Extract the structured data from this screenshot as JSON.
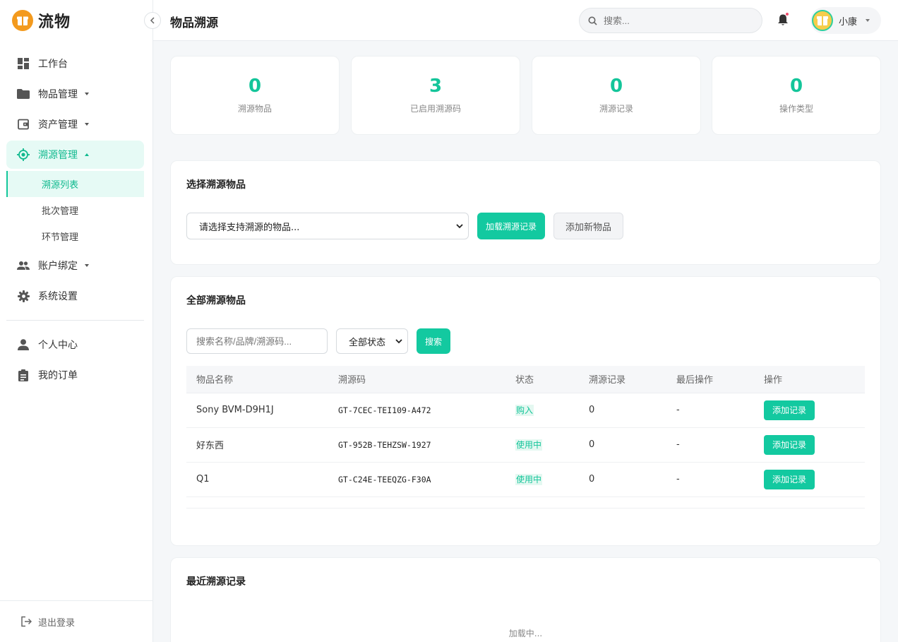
{
  "brand": {
    "name": "流物"
  },
  "header": {
    "title": "物品溯源",
    "search_placeholder": "搜索...",
    "user_name": "小康"
  },
  "sidebar": {
    "items": [
      {
        "label": "工作台"
      },
      {
        "label": "物品管理"
      },
      {
        "label": "资产管理"
      },
      {
        "label": "溯源管理"
      },
      {
        "label": "账户绑定"
      },
      {
        "label": "系统设置"
      },
      {
        "label": "个人中心"
      },
      {
        "label": "我的订单"
      }
    ],
    "sub_items": [
      {
        "label": "溯源列表"
      },
      {
        "label": "批次管理"
      },
      {
        "label": "环节管理"
      }
    ],
    "logout": "退出登录"
  },
  "stats": [
    {
      "value": "0",
      "label": "溯源物品"
    },
    {
      "value": "3",
      "label": "已启用溯源码"
    },
    {
      "value": "0",
      "label": "溯源记录"
    },
    {
      "value": "0",
      "label": "操作类型"
    }
  ],
  "select_panel": {
    "title": "选择溯源物品",
    "select_value": "请选择支持溯源的物品...",
    "load_button": "加载溯源记录",
    "add_button": "添加新物品"
  },
  "items_panel": {
    "title": "全部溯源物品",
    "search_placeholder": "搜索名称/品牌/溯源码...",
    "status_filter": "全部状态",
    "search_button": "搜索",
    "columns": [
      "物品名称",
      "溯源码",
      "状态",
      "溯源记录",
      "最后操作",
      "操作"
    ],
    "rows": [
      {
        "name": "Sony BVM-D9H1J",
        "code": "GT-7CEC-TEI109-A472",
        "status": "购入",
        "records": "0",
        "last": "-",
        "action": "添加记录"
      },
      {
        "name": "好东西",
        "code": "GT-952B-TEHZSW-1927",
        "status": "使用中",
        "records": "0",
        "last": "-",
        "action": "添加记录"
      },
      {
        "name": "Q1",
        "code": "GT-C24E-TEEQZG-F30A",
        "status": "使用中",
        "records": "0",
        "last": "-",
        "action": "添加记录"
      }
    ]
  },
  "recent_panel": {
    "title": "最近溯源记录",
    "loading": "加载中..."
  }
}
